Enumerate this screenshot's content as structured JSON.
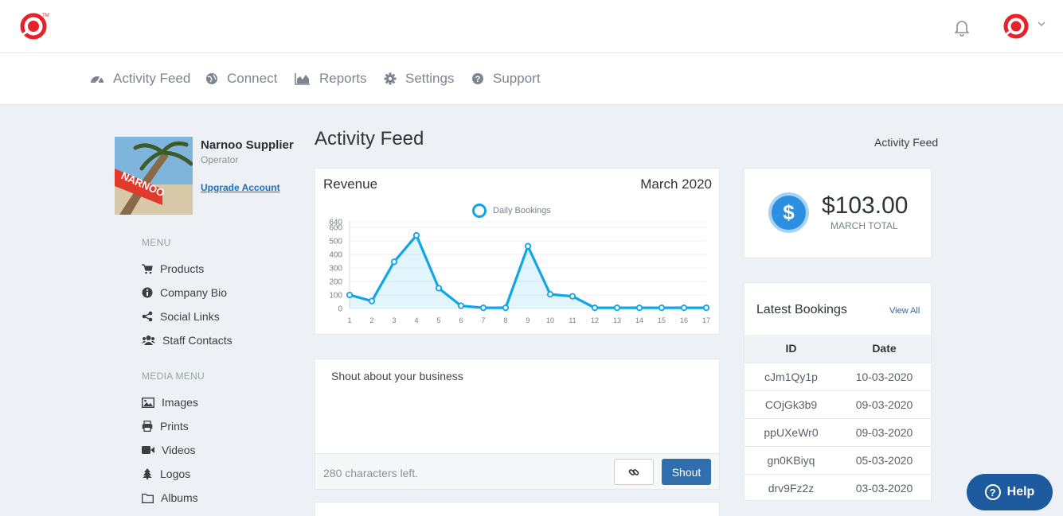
{
  "header": {
    "logo_icon": "narnoo-logo-icon",
    "notification_icon": "bell-icon",
    "brand_color": "#e8202a"
  },
  "nav": {
    "items": [
      {
        "label": "Activity Feed",
        "icon": "dashboard-icon"
      },
      {
        "label": "Connect",
        "icon": "globe-icon"
      },
      {
        "label": "Reports",
        "icon": "area-chart-icon"
      },
      {
        "label": "Settings",
        "icon": "gear-icon"
      },
      {
        "label": "Support",
        "icon": "question-circle-icon"
      }
    ]
  },
  "profile": {
    "name": "Narnoo Supplier",
    "role": "Operator",
    "upgrade_label": "Upgrade Account"
  },
  "menu": {
    "title": "MENU",
    "items": [
      {
        "label": "Products",
        "icon": "cart-icon"
      },
      {
        "label": "Company Bio",
        "icon": "info-icon"
      },
      {
        "label": "Social Links",
        "icon": "share-icon"
      },
      {
        "label": "Staff Contacts",
        "icon": "users-icon"
      }
    ]
  },
  "media_menu": {
    "title": "MEDIA MENU",
    "items": [
      {
        "label": "Images",
        "icon": "image-icon"
      },
      {
        "label": "Prints",
        "icon": "print-icon"
      },
      {
        "label": "Videos",
        "icon": "video-icon"
      },
      {
        "label": "Logos",
        "icon": "tree-icon"
      },
      {
        "label": "Albums",
        "icon": "folder-icon"
      }
    ]
  },
  "main": {
    "title": "Activity Feed",
    "breadcrumb": "Activity Feed"
  },
  "revenue": {
    "title": "Revenue",
    "period": "March 2020"
  },
  "chart_data": {
    "type": "area",
    "x": [
      1,
      2,
      3,
      4,
      5,
      6,
      7,
      8,
      9,
      10,
      11,
      12,
      13,
      14,
      15,
      16,
      17
    ],
    "series": [
      {
        "name": "Daily Bookings",
        "values": [
          100,
          55,
          345,
          540,
          150,
          20,
          5,
          5,
          460,
          105,
          90,
          5,
          5,
          5,
          5,
          5,
          5
        ]
      }
    ],
    "yticks": [
      0,
      100,
      200,
      300,
      400,
      500,
      600,
      640
    ],
    "ylim": [
      0,
      640
    ],
    "grid": true,
    "legend": "top-center",
    "color": "#0ea5e9"
  },
  "shout": {
    "placeholder": "Shout about your business",
    "chars_left": "280 characters left.",
    "button_label": "Shout",
    "link_icon": "link-icon"
  },
  "total": {
    "amount": "$103.00",
    "label": "MARCH TOTAL",
    "icon": "dollar-icon"
  },
  "bookings": {
    "title": "Latest Bookings",
    "view_all": "View All",
    "columns": [
      "ID",
      "Date"
    ],
    "rows": [
      {
        "id": "cJm1Qy1p",
        "date": "10-03-2020"
      },
      {
        "id": "COjGk3b9",
        "date": "09-03-2020"
      },
      {
        "id": "ppUXeWr0",
        "date": "09-03-2020"
      },
      {
        "id": "gn0KBiyq",
        "date": "05-03-2020"
      },
      {
        "id": "drv9Fz2z",
        "date": "03-03-2020"
      }
    ]
  },
  "help": {
    "label": "Help"
  }
}
